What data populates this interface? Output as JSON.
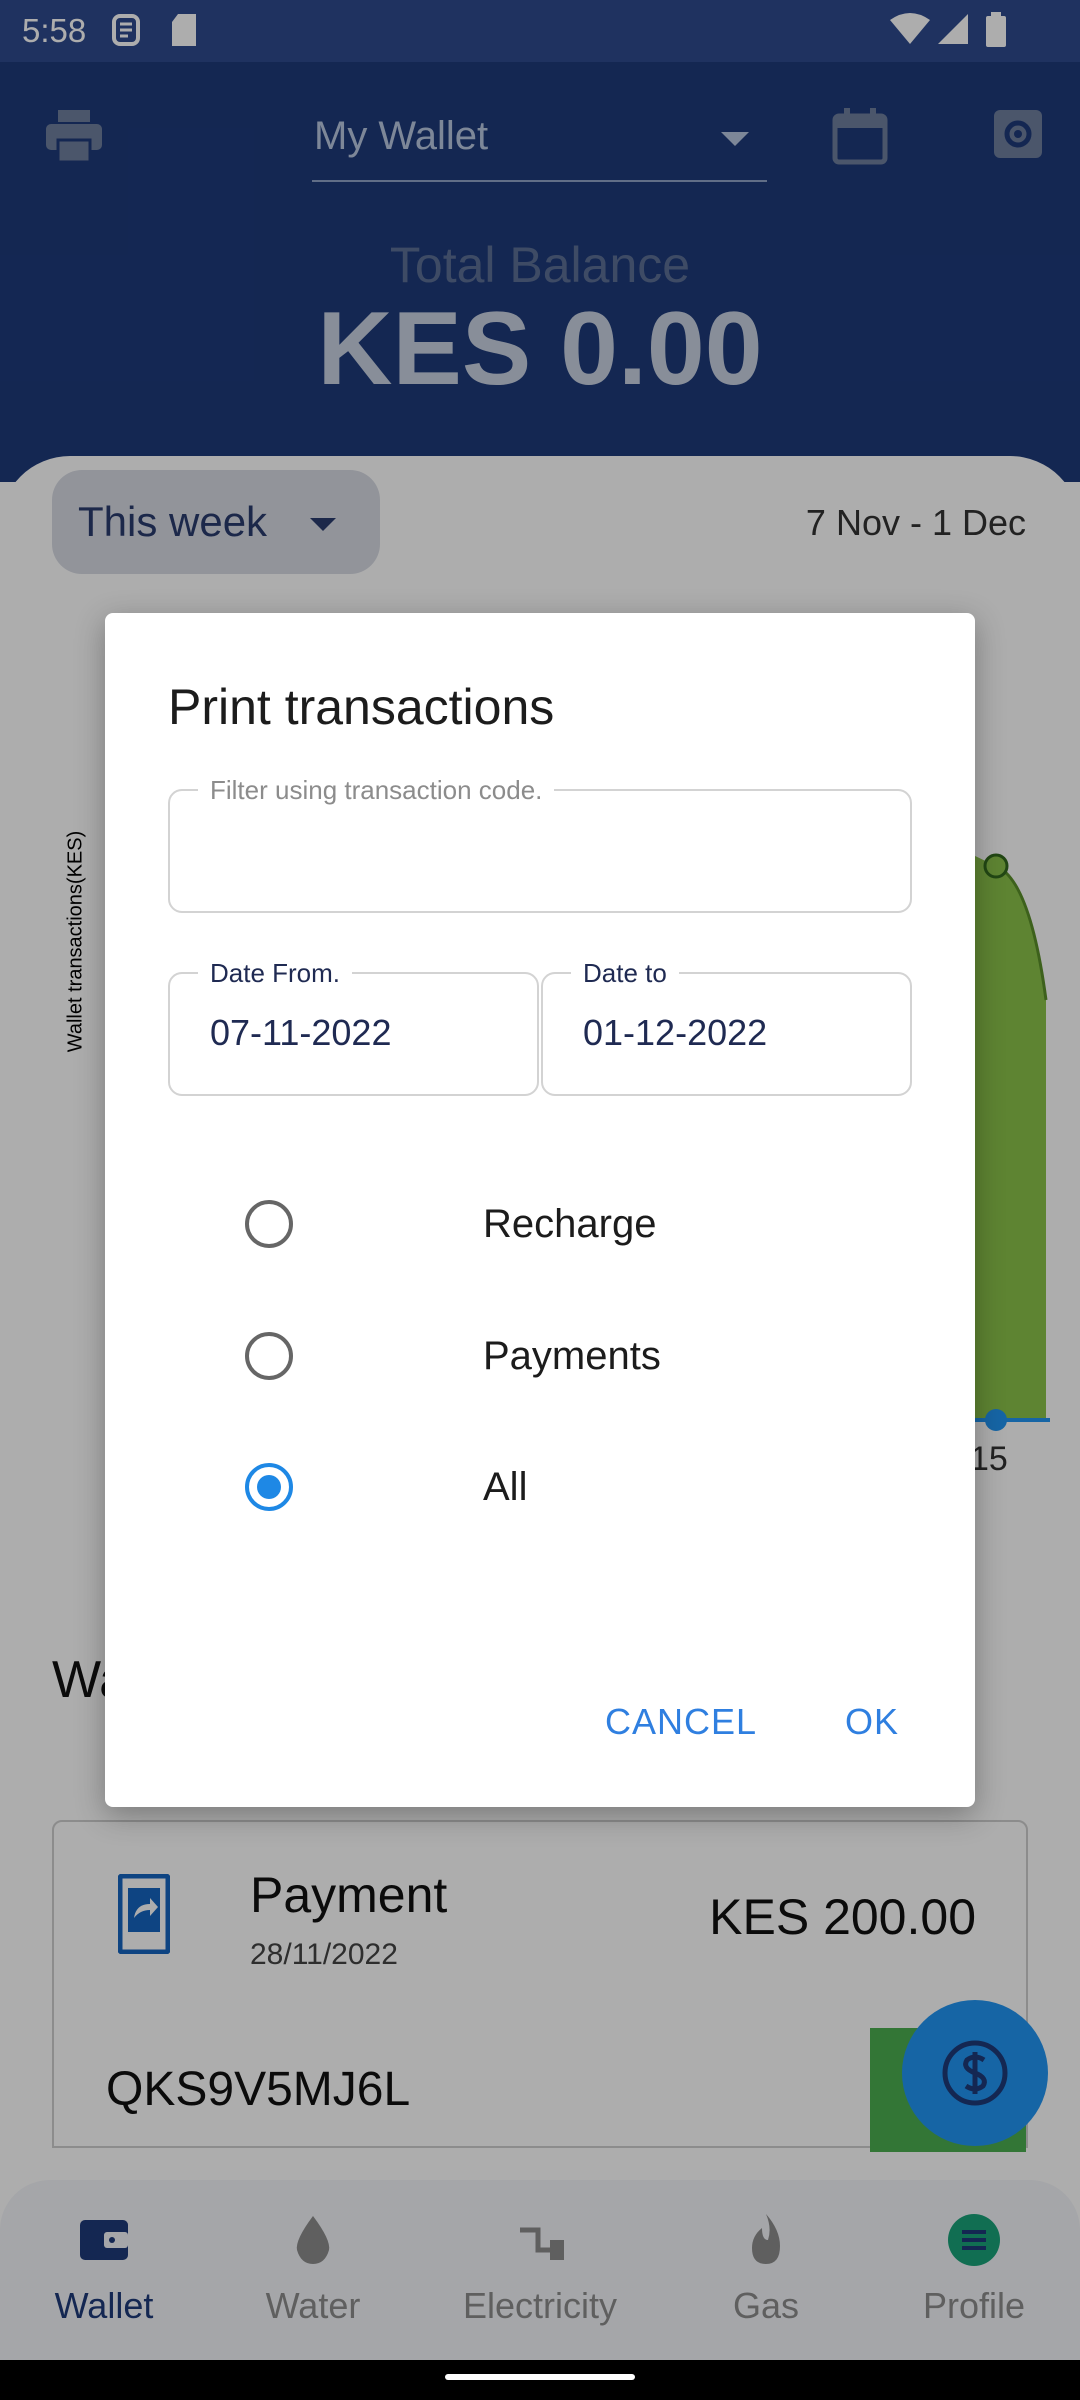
{
  "status_bar": {
    "time": "5:58"
  },
  "header": {
    "wallet_name": "My Wallet",
    "total_label": "Total Balance",
    "total_value": "KES 0.00"
  },
  "filter": {
    "period": "This week",
    "date_range": "7 Nov - 1 Dec"
  },
  "chart": {
    "y_label": "Wallet transactions(KES)",
    "x_tick": "15"
  },
  "section": {
    "title_partial": "Wa"
  },
  "transactions": [
    {
      "title": "Payment",
      "date": "28/11/2022",
      "amount": "KES 200.00",
      "code": "QKS9V5MJ6L"
    }
  ],
  "dialog": {
    "title": "Print transactions",
    "code_filter": {
      "label": "Filter using transaction code.",
      "value": ""
    },
    "date_from": {
      "label": "Date From.",
      "value": "07-11-2022"
    },
    "date_to": {
      "label": "Date to",
      "value": "01-12-2022"
    },
    "options": [
      {
        "label": "Recharge",
        "checked": false
      },
      {
        "label": "Payments",
        "checked": false
      },
      {
        "label": "All",
        "checked": true
      }
    ],
    "cancel_label": "CANCEL",
    "ok_label": "OK"
  },
  "bottom_nav": [
    {
      "label": "Wallet",
      "icon": "wallet-icon",
      "active": true
    },
    {
      "label": "Water",
      "icon": "water-drop-icon",
      "active": false
    },
    {
      "label": "Electricity",
      "icon": "plug-icon",
      "active": false
    },
    {
      "label": "Gas",
      "icon": "flame-icon",
      "active": false
    },
    {
      "label": "Profile",
      "icon": "menu-icon",
      "active": false
    }
  ],
  "colors": {
    "primary": "#1e3a7a",
    "accent": "#2f7fe0",
    "radio_checked": "#1e88e5"
  }
}
